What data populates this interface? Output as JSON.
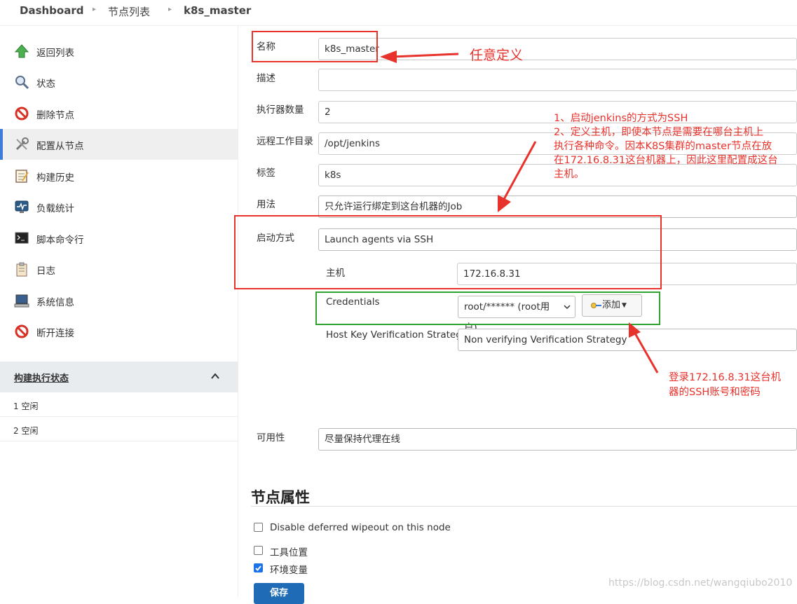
{
  "breadcrumb": {
    "dashboard": "Dashboard",
    "node_list": "节点列表",
    "current": "k8s_master"
  },
  "sidebar": {
    "items": [
      {
        "label": "返回列表",
        "icon": "arrow-up-icon"
      },
      {
        "label": "状态",
        "icon": "search-icon"
      },
      {
        "label": "删除节点",
        "icon": "prohibit-icon"
      },
      {
        "label": "配置从节点",
        "icon": "wrench-icon"
      },
      {
        "label": "构建历史",
        "icon": "notepad-icon"
      },
      {
        "label": "负载统计",
        "icon": "monitor-graph-icon"
      },
      {
        "label": "脚本命令行",
        "icon": "terminal-icon"
      },
      {
        "label": "日志",
        "icon": "clipboard-icon"
      },
      {
        "label": "系统信息",
        "icon": "computer-icon"
      },
      {
        "label": "断开连接",
        "icon": "prohibit-icon"
      }
    ],
    "executor_title": "构建执行状态",
    "executors": [
      "1  空闲",
      "2  空闲"
    ]
  },
  "form": {
    "name_label": "名称",
    "name_value": "k8s_master",
    "desc_label": "描述",
    "desc_value": "",
    "executors_label": "执行器数量",
    "executors_value": "2",
    "remote_dir_label": "远程工作目录",
    "remote_dir_value": "/opt/jenkins",
    "labels_label": "标签",
    "labels_value": "k8s",
    "usage_label": "用法",
    "usage_value": "只允许运行绑定到这台机器的Job",
    "launch_label": "启动方式",
    "launch_value": "Launch agents via SSH",
    "host_label": "主机",
    "host_value": "172.16.8.31",
    "credentials_label": "Credentials",
    "credentials_value": "root/****** (root用户)",
    "add_button": "添加",
    "hkvs_label": "Host Key Verification Strategy",
    "hkvs_value": "Non verifying Verification Strategy",
    "availability_label": "可用性",
    "availability_value": "尽量保持代理在线"
  },
  "node_properties": {
    "title": "节点属性",
    "options": [
      {
        "label": "Disable deferred wipeout on this node",
        "checked": false
      },
      {
        "label": "工具位置",
        "checked": false
      },
      {
        "label": "环境变量",
        "checked": true
      }
    ],
    "save_button": "保存"
  },
  "annotations": {
    "name_note": "任意定义",
    "ssh_note_lines": [
      "1、启动jenkins的方式为SSH",
      "2、定义主机，即使本节点是需要在哪台主机上",
      "执行各种命令。因本K8S集群的master节点在放",
      "在172.16.8.31这台机器上，因此这里配置成这台",
      "主机。"
    ],
    "cred_note_lines": [
      "登录172.16.8.31这台机",
      "器的SSH账号和密码"
    ]
  },
  "watermark": "https://blog.csdn.net/wangqiubo2010",
  "colors": {
    "annotation_red": "#e8322c",
    "annotation_green": "#2fa32f",
    "active_accent": "#3b7dd8",
    "save_blue": "#1f6bb5"
  }
}
